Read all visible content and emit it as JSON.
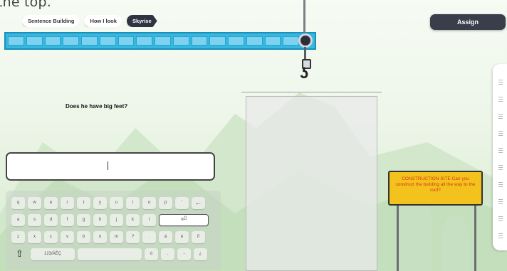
{
  "caption": "the top.",
  "breadcrumbs": [
    {
      "label": "Sentence Building",
      "active": false
    },
    {
      "label": "How I look",
      "active": false
    },
    {
      "label": "Skyrise",
      "active": true
    }
  ],
  "header": {
    "assign_label": "Assign"
  },
  "prompt": {
    "question": "Does he have big feet?"
  },
  "answer": {
    "value": ""
  },
  "keyboard": {
    "row1": [
      "q",
      "w",
      "e",
      "r",
      "t",
      "y",
      "u",
      "i",
      "o",
      "p",
      "'"
    ],
    "backspace": "←",
    "row2": [
      "a",
      "s",
      "d",
      "f",
      "g",
      "h",
      "j",
      "k",
      "l"
    ],
    "enter": "⏎",
    "row3": [
      "z",
      "x",
      "c",
      "v",
      "b",
      "n",
      "m",
      "?",
      ".",
      "á",
      "é",
      "ñ"
    ],
    "shift": "⇧",
    "mode_label": "123/ÁÉÇ",
    "row4_right": [
      "ó",
      ".",
      "-",
      "¿"
    ]
  },
  "sign": {
    "text": "CONSTRUCTION SITE Can you construct the building all the way to the roof?"
  },
  "colors": {
    "crane": "#35b7e0",
    "sign": "#f4c21d",
    "sign_text": "#d13a1b",
    "assign": "#3a3d4a"
  }
}
